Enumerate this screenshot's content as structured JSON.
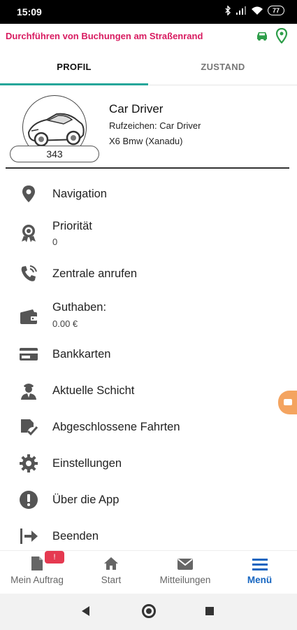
{
  "status_bar": {
    "time": "15:09",
    "battery": "77",
    "icons": [
      "bluetooth-icon",
      "signal-icon",
      "wifi-icon",
      "battery-icon"
    ]
  },
  "header": {
    "title": "Durchführen von Buchungen am Straßenrand",
    "title_color": "#d81b60",
    "accent_color": "#2e9e4a",
    "icons": [
      "car-icon",
      "location-pin-icon"
    ]
  },
  "tabs": [
    {
      "label": "PROFIL",
      "active": true
    },
    {
      "label": "ZUSTAND",
      "active": false
    }
  ],
  "profile": {
    "badge": "343",
    "name": "Car Driver",
    "callsign": "Rufzeichen: Car Driver",
    "vehicle": "X6 Bmw (Xanadu)"
  },
  "menu": [
    {
      "label": "Navigation",
      "icon": "location-pin-icon"
    },
    {
      "label": "Priorität",
      "value": "0",
      "icon": "award-icon"
    },
    {
      "label": "Zentrale anrufen",
      "icon": "phone-ring-icon"
    },
    {
      "label": "Guthaben:",
      "value": "0.00 €",
      "icon": "wallet-icon"
    },
    {
      "label": "Bankkarten",
      "icon": "credit-card-icon"
    },
    {
      "label": "Aktuelle Schicht",
      "icon": "driver-icon"
    },
    {
      "label": "Abgeschlossene Fahrten",
      "icon": "completed-trips-icon"
    },
    {
      "label": "Einstellungen",
      "icon": "gear-icon"
    },
    {
      "label": "Über die App",
      "icon": "info-alert-icon"
    },
    {
      "label": "Beenden",
      "icon": "exit-icon"
    }
  ],
  "bottom_nav": [
    {
      "label": "Mein Auftrag",
      "icon": "document-icon",
      "badge": "!"
    },
    {
      "label": "Start",
      "icon": "home-icon"
    },
    {
      "label": "Mitteilungen",
      "icon": "mail-icon"
    },
    {
      "label": "Menü",
      "icon": "hamburger-menu-icon",
      "active": true
    }
  ],
  "colors": {
    "tab_indicator": "#26a69a",
    "active_nav": "#1565c0",
    "badge": "#e53950",
    "floating_button": "#f4a460"
  }
}
